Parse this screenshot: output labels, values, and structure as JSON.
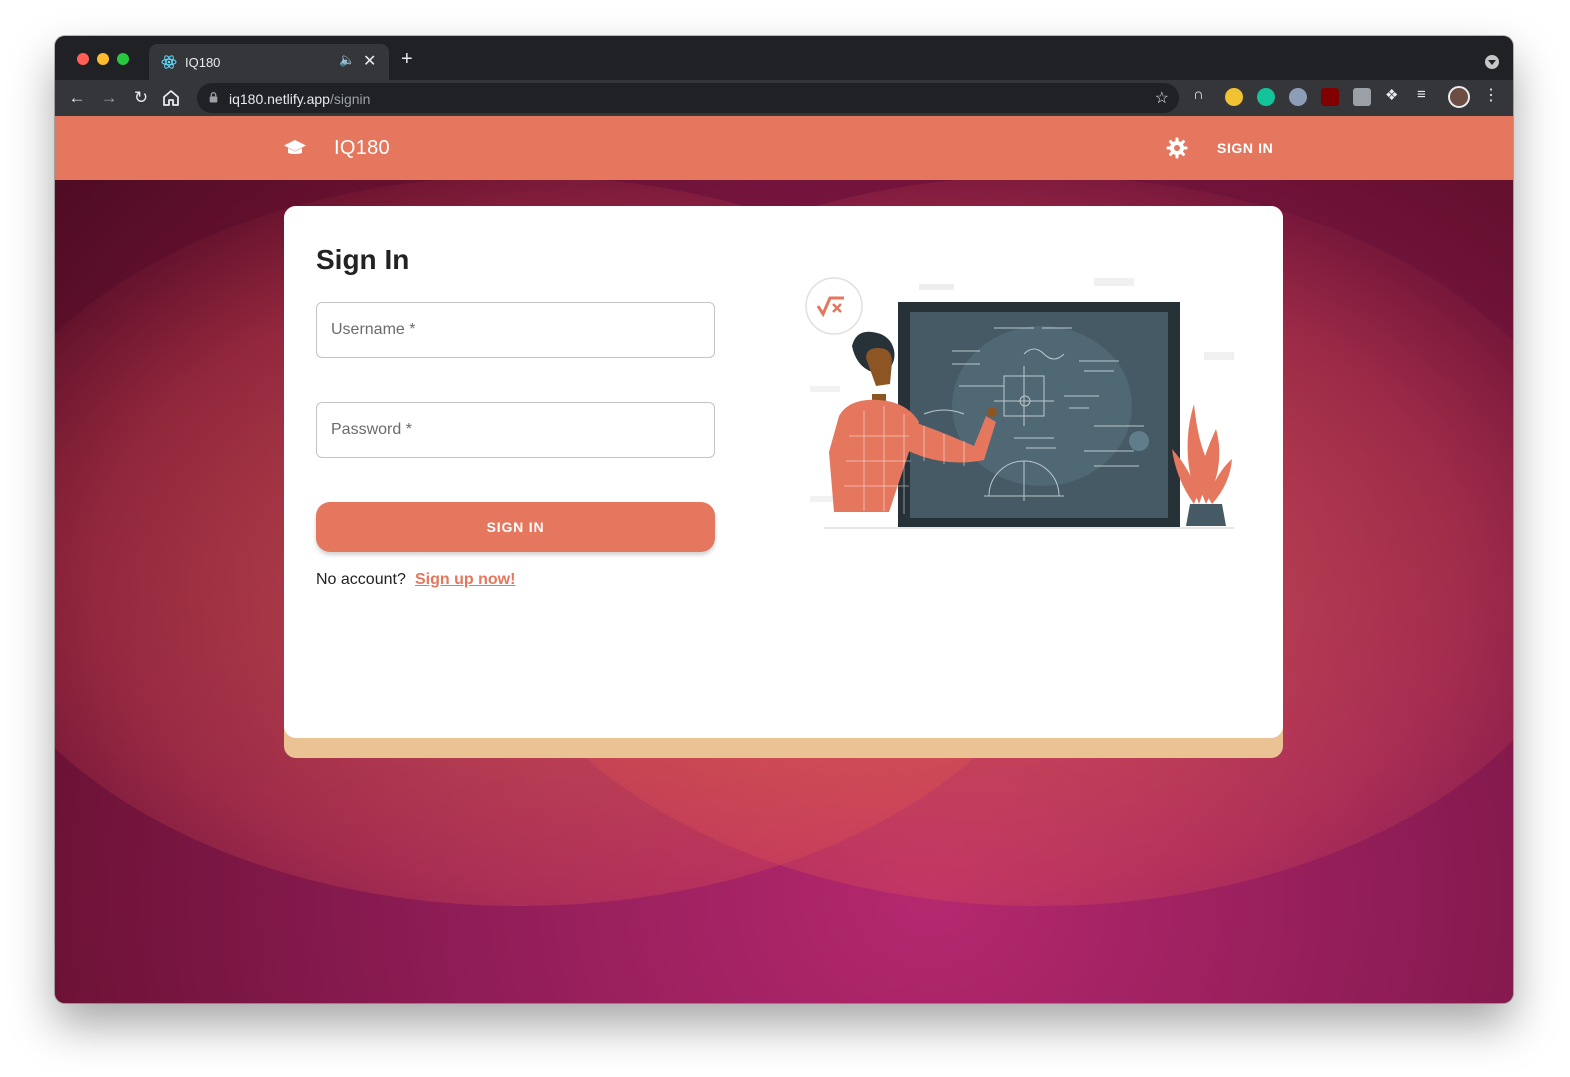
{
  "browser": {
    "tab": {
      "title": "IQ180"
    },
    "address": {
      "host": "iq180.netlify.app",
      "path": "/signin"
    }
  },
  "app": {
    "title": "IQ180",
    "nav": {
      "signin_label": "SIGN IN"
    }
  },
  "signin_card": {
    "heading": "Sign In",
    "username_label": "Username *",
    "password_label": "Password *",
    "submit_label": "SIGN IN",
    "no_account_text": "No account?",
    "signup_link_text": "Sign up now!"
  },
  "colors": {
    "accent": "#e4775e",
    "card_footer": "#ebc294",
    "background": "#8d1c55"
  },
  "icons": {
    "app_logo": "graduation-cap-icon",
    "settings": "gear-icon",
    "tab_favicon": "react-atom-icon"
  }
}
